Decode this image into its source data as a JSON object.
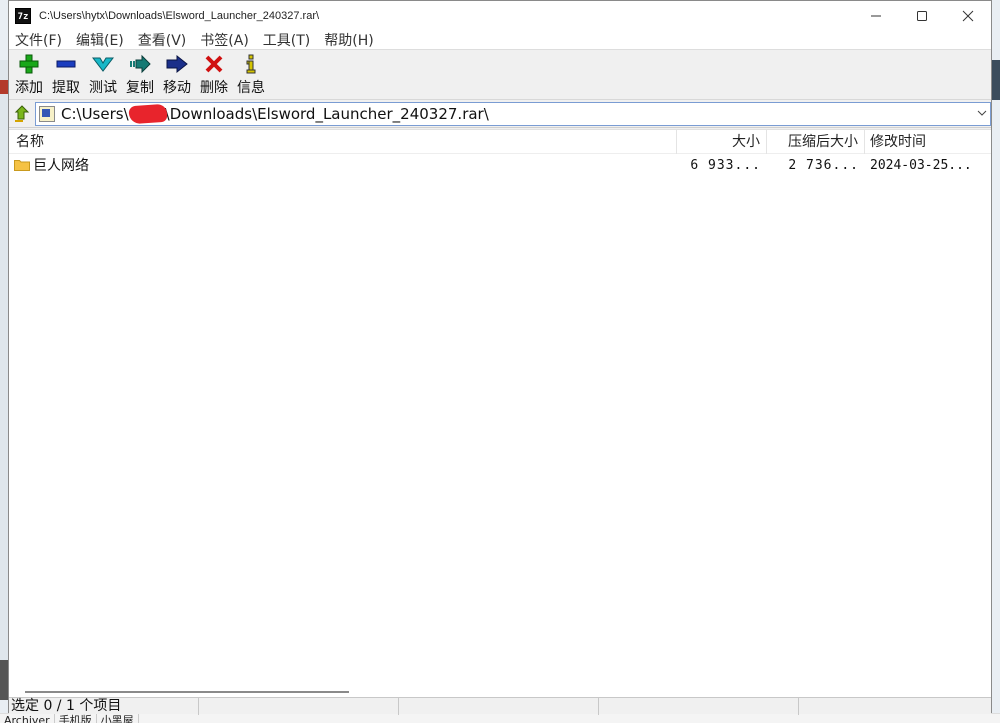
{
  "window": {
    "icon_text": "7z",
    "title": "C:\\Users\\hytx\\Downloads\\Elsword_Launcher_240327.rar\\",
    "controls": {
      "minimize": "—",
      "maximize": "☐",
      "close": "✕"
    }
  },
  "menu": {
    "items": [
      {
        "label": "文件(F)"
      },
      {
        "label": "编辑(E)"
      },
      {
        "label": "查看(V)"
      },
      {
        "label": "书签(A)"
      },
      {
        "label": "工具(T)"
      },
      {
        "label": "帮助(H)"
      }
    ]
  },
  "toolbar": {
    "buttons": [
      {
        "label": "添加",
        "icon": "plus-icon",
        "color": "#1aa81a"
      },
      {
        "label": "提取",
        "icon": "minus-icon",
        "color": "#1b3dbf"
      },
      {
        "label": "测试",
        "icon": "check-chevron-icon",
        "color": "#18b8c8"
      },
      {
        "label": "复制",
        "icon": "copy-arrow-icon",
        "color": "#157a74"
      },
      {
        "label": "移动",
        "icon": "move-arrow-icon",
        "color": "#1b2f8a"
      },
      {
        "label": "删除",
        "icon": "delete-x-icon",
        "color": "#d01010"
      },
      {
        "label": "信息",
        "icon": "info-icon",
        "color": "#d4c400"
      }
    ]
  },
  "address": {
    "path_prefix": "C:\\Users\\",
    "path_suffix": "\\Downloads\\Elsword_Launcher_240327.rar\\"
  },
  "columns": {
    "name": "名称",
    "size": "大小",
    "packed": "压缩后大小",
    "modified": "修改时间"
  },
  "files": [
    {
      "name": "巨人网络",
      "size": "6 933...",
      "packed": "2 736...",
      "modified": "2024-03-25..."
    }
  ],
  "status": {
    "selected": "选定 0 / 1 个项目",
    "cells": [
      "",
      "",
      "",
      ""
    ]
  },
  "taskbar_bits": [
    "Archiver",
    "手机版",
    "小黑屋"
  ]
}
